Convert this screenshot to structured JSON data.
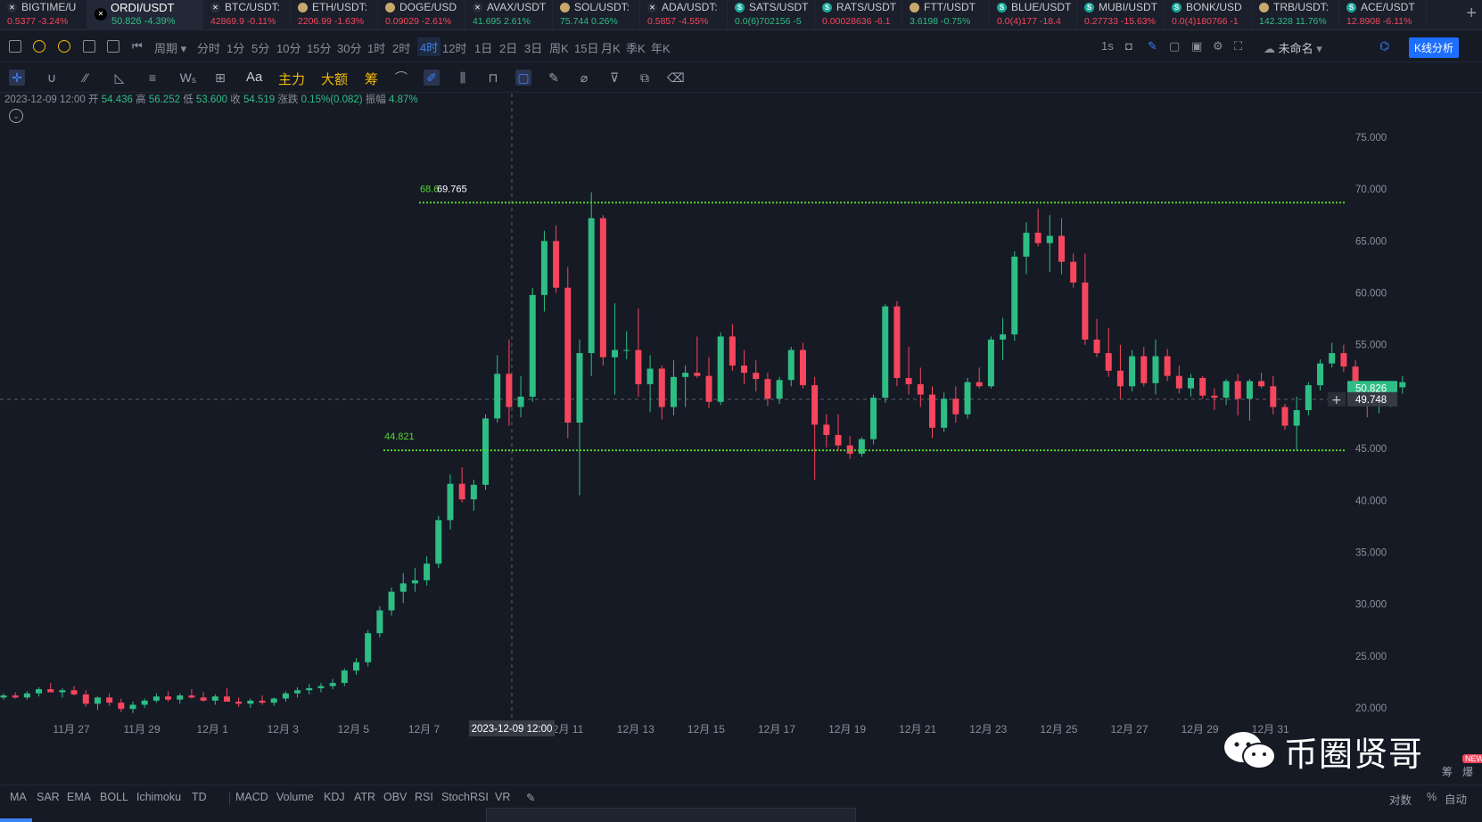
{
  "tickers": [
    {
      "symbol": "BIGTIME/U",
      "price": "0.5377",
      "change": "-3.24%",
      "dir": "dn",
      "icon": "x-logo-icon"
    },
    {
      "symbol": "ORDI/USDT",
      "price": "50.826",
      "change": "-4.39%",
      "dir": "up",
      "icon": "x-logo-icon",
      "active": true
    },
    {
      "symbol": "BTC/USDT:",
      "price": "42869.9",
      "change": "-0.11%",
      "dir": "dn",
      "icon": "x-logo-icon"
    },
    {
      "symbol": "ETH/USDT:",
      "price": "2206.99",
      "change": "-1.63%",
      "dir": "dn",
      "icon": "coin-icon"
    },
    {
      "symbol": "DOGE/USD",
      "price": "0.09029",
      "change": "-2.61%",
      "dir": "dn",
      "icon": "coin-icon"
    },
    {
      "symbol": "AVAX/USDT",
      "price": "41.695",
      "change": "2.61%",
      "dir": "up",
      "icon": "x-logo-icon"
    },
    {
      "symbol": "SOL/USDT:",
      "price": "75.744",
      "change": "0.26%",
      "dir": "up",
      "icon": "coin-icon"
    },
    {
      "symbol": "ADA/USDT:",
      "price": "0.5857",
      "change": "-4.55%",
      "dir": "dn",
      "icon": "x-logo-icon"
    },
    {
      "symbol": "SATS/USDT",
      "price": "0.0(6)702156",
      "change": "-5",
      "dir": "up",
      "icon": "s-logo-icon"
    },
    {
      "symbol": "RATS/USDT",
      "price": "0.00028636",
      "change": "-6.1",
      "dir": "dn",
      "icon": "s-logo-icon"
    },
    {
      "symbol": "FTT/USDT",
      "price": "3.6198",
      "change": "-0.75%",
      "dir": "up",
      "icon": "coin-icon"
    },
    {
      "symbol": "BLUE/USDT",
      "price": "0.0(4)177",
      "change": "-18.4",
      "dir": "dn",
      "icon": "s-logo-icon"
    },
    {
      "symbol": "MUBI/USDT",
      "price": "0.27733",
      "change": "-15.63%",
      "dir": "dn",
      "icon": "s-logo-icon"
    },
    {
      "symbol": "BONK/USD",
      "price": "0.0(4)180766",
      "change": "-1",
      "dir": "dn",
      "icon": "s-logo-icon"
    },
    {
      "symbol": "TRB/USDT:",
      "price": "142.328",
      "change": "11.76%",
      "dir": "up",
      "icon": "coin-icon"
    },
    {
      "symbol": "ACE/USDT",
      "price": "12.8908",
      "change": "-6.11%",
      "dir": "dn",
      "icon": "s-logo-icon"
    }
  ],
  "toolbar": {
    "period_label": "周期",
    "intervals": [
      "分时",
      "1分",
      "5分",
      "10分",
      "15分",
      "30分",
      "1时",
      "2时",
      "4时",
      "12时",
      "1日",
      "2日",
      "3日",
      "周K",
      "15日",
      "月K",
      "季K",
      "年K"
    ],
    "selected_interval": "4时",
    "refresh_label": "1s",
    "layout_name": "未命名",
    "kline_button": "K线分析"
  },
  "drawing_toolbar": {
    "text_tool": "Aa",
    "main_force": "主力",
    "big_amount": "大额",
    "chips": "筹"
  },
  "ohlc": {
    "datetime": "2023-12-09 12:00",
    "open_label": "开",
    "open": "54.436",
    "high_label": "高",
    "high": "56.252",
    "low_label": "低",
    "low": "53.600",
    "close_label": "收",
    "close": "54.519",
    "change_label": "涨跌",
    "change": "0.15%(0.082)",
    "amp_label": "振幅",
    "amp": "4.87%"
  },
  "chart_data": {
    "type": "candlestick",
    "ylim": [
      20000,
      76000
    ],
    "y_ticks": [
      "75.000",
      "70.000",
      "65.000",
      "60.000",
      "55.000",
      "50.000",
      "45.000",
      "40.000",
      "35.000",
      "30.000",
      "25.000",
      "20.000"
    ],
    "y_tick_values": [
      75,
      70,
      65,
      60,
      55,
      50,
      45,
      40,
      35,
      30,
      25,
      20
    ],
    "x_ticks": [
      "11月 27",
      "11月 29",
      "12月 1",
      "12月 3",
      "12月 5",
      "12月 7",
      "12月 9",
      "12月 11",
      "12月 13",
      "12月 15",
      "12月 17",
      "12月 19",
      "12月 21",
      "12月 23",
      "12月 25",
      "12月 27",
      "12月 29",
      "12月 31"
    ],
    "last_price": "50.826",
    "cursor_price": "49.748",
    "cursor_time": "2023-12-09 12:00",
    "resistance_level": 68.7,
    "resistance_label": "68.6",
    "peak_label": "69.765",
    "support_level": 44.82,
    "support_label": "44.821",
    "candles": [
      [
        21.0,
        21.4,
        20.8,
        21.2
      ],
      [
        21.2,
        21.5,
        20.9,
        21.0
      ],
      [
        21.0,
        21.6,
        20.8,
        21.4
      ],
      [
        21.4,
        22.0,
        21.1,
        21.8
      ],
      [
        21.8,
        22.4,
        21.5,
        21.5
      ],
      [
        21.5,
        21.9,
        21.0,
        21.7
      ],
      [
        21.7,
        22.1,
        21.2,
        21.3
      ],
      [
        21.3,
        21.7,
        20.1,
        20.4
      ],
      [
        20.4,
        21.1,
        19.8,
        21.0
      ],
      [
        21.0,
        21.4,
        20.2,
        20.5
      ],
      [
        20.5,
        20.9,
        19.6,
        19.9
      ],
      [
        19.9,
        20.6,
        19.5,
        20.3
      ],
      [
        20.3,
        20.9,
        20.0,
        20.7
      ],
      [
        20.7,
        21.4,
        20.5,
        21.1
      ],
      [
        21.1,
        21.6,
        20.6,
        20.8
      ],
      [
        20.8,
        21.4,
        20.4,
        21.2
      ],
      [
        21.2,
        21.8,
        20.9,
        21.0
      ],
      [
        21.0,
        21.5,
        20.6,
        20.7
      ],
      [
        20.7,
        21.3,
        20.3,
        21.1
      ],
      [
        21.1,
        21.9,
        20.8,
        20.6
      ],
      [
        20.6,
        21.0,
        20.1,
        20.4
      ],
      [
        20.4,
        20.9,
        20.0,
        20.7
      ],
      [
        20.7,
        21.2,
        20.3,
        20.5
      ],
      [
        20.5,
        21.0,
        20.2,
        20.9
      ],
      [
        20.9,
        21.6,
        20.6,
        21.4
      ],
      [
        21.4,
        22.0,
        21.0,
        21.7
      ],
      [
        21.7,
        22.3,
        21.3,
        21.9
      ],
      [
        21.9,
        22.4,
        21.5,
        22.1
      ],
      [
        22.1,
        22.8,
        21.8,
        22.4
      ],
      [
        22.4,
        23.8,
        22.1,
        23.6
      ],
      [
        23.6,
        24.8,
        23.2,
        24.4
      ],
      [
        24.4,
        27.5,
        24.0,
        27.2
      ],
      [
        27.2,
        29.8,
        26.8,
        29.4
      ],
      [
        29.4,
        31.6,
        28.9,
        31.2
      ],
      [
        31.2,
        33.0,
        30.1,
        32.0
      ],
      [
        32.0,
        33.5,
        31.2,
        32.3
      ],
      [
        32.3,
        34.6,
        31.8,
        33.9
      ],
      [
        33.9,
        38.5,
        33.5,
        38.1
      ],
      [
        38.1,
        42.5,
        37.2,
        41.6
      ],
      [
        41.6,
        43.2,
        39.8,
        40.1
      ],
      [
        40.1,
        42.0,
        39.0,
        41.5
      ],
      [
        41.5,
        48.3,
        41.0,
        47.9
      ],
      [
        47.9,
        54.0,
        47.5,
        52.2
      ],
      [
        52.2,
        55.5,
        47.2,
        49.0
      ],
      [
        49.0,
        52.0,
        48.0,
        50.0
      ],
      [
        50.0,
        60.5,
        49.5,
        59.8
      ],
      [
        59.8,
        66.0,
        58.2,
        65.0
      ],
      [
        65.0,
        66.5,
        60.0,
        60.5
      ],
      [
        60.5,
        62.5,
        46.0,
        47.5
      ],
      [
        47.5,
        55.5,
        40.5,
        54.2
      ],
      [
        54.2,
        69.7,
        52.0,
        67.2
      ],
      [
        67.2,
        67.5,
        53.0,
        53.8
      ],
      [
        53.8,
        59.0,
        50.2,
        54.5
      ],
      [
        54.5,
        56.3,
        53.6,
        54.5
      ],
      [
        54.5,
        58.5,
        50.0,
        51.2
      ],
      [
        51.2,
        54.0,
        48.5,
        52.7
      ],
      [
        52.7,
        53.0,
        47.8,
        49.0
      ],
      [
        49.0,
        53.5,
        48.2,
        51.9
      ],
      [
        51.9,
        53.0,
        49.0,
        52.3
      ],
      [
        52.3,
        55.8,
        51.8,
        52.0
      ],
      [
        52.0,
        53.8,
        48.9,
        49.5
      ],
      [
        49.5,
        56.2,
        49.2,
        55.8
      ],
      [
        55.8,
        57.0,
        52.5,
        53.0
      ],
      [
        53.0,
        54.5,
        51.2,
        52.3
      ],
      [
        52.3,
        53.5,
        50.5,
        51.7
      ],
      [
        51.7,
        52.3,
        49.1,
        49.8
      ],
      [
        49.8,
        51.9,
        49.3,
        51.6
      ],
      [
        51.6,
        54.8,
        51.0,
        54.5
      ],
      [
        54.5,
        55.2,
        50.8,
        51.1
      ],
      [
        51.1,
        51.9,
        42.0,
        47.3
      ],
      [
        47.3,
        48.3,
        45.1,
        46.3
      ],
      [
        46.3,
        48.3,
        44.8,
        45.3
      ],
      [
        45.3,
        46.2,
        44.0,
        44.5
      ],
      [
        44.5,
        46.1,
        44.2,
        45.9
      ],
      [
        45.9,
        50.2,
        45.4,
        49.9
      ],
      [
        49.9,
        58.9,
        49.4,
        58.7
      ],
      [
        58.7,
        59.2,
        51.0,
        51.8
      ],
      [
        51.8,
        54.8,
        50.2,
        51.2
      ],
      [
        51.2,
        52.8,
        49.0,
        50.2
      ],
      [
        50.2,
        51.0,
        46.0,
        47.0
      ],
      [
        47.0,
        50.4,
        46.6,
        49.8
      ],
      [
        49.8,
        51.0,
        47.5,
        48.3
      ],
      [
        48.3,
        51.8,
        47.9,
        51.4
      ],
      [
        51.4,
        52.8,
        50.8,
        51.0
      ],
      [
        51.0,
        55.8,
        50.8,
        55.5
      ],
      [
        55.5,
        57.6,
        53.5,
        56.0
      ],
      [
        56.0,
        64.0,
        55.4,
        63.5
      ],
      [
        63.5,
        66.8,
        61.8,
        65.8
      ],
      [
        65.8,
        68.1,
        64.5,
        64.8
      ],
      [
        64.8,
        67.5,
        62.0,
        65.5
      ],
      [
        65.5,
        67.2,
        61.8,
        63.0
      ],
      [
        63.0,
        63.8,
        60.5,
        61.0
      ],
      [
        61.0,
        63.8,
        55.0,
        55.5
      ],
      [
        55.5,
        57.5,
        53.8,
        54.2
      ],
      [
        54.2,
        56.6,
        51.9,
        52.5
      ],
      [
        52.5,
        55.0,
        49.8,
        51.0
      ],
      [
        51.0,
        54.5,
        50.5,
        53.9
      ],
      [
        53.9,
        54.8,
        51.0,
        51.3
      ],
      [
        51.3,
        55.5,
        50.2,
        53.9
      ],
      [
        53.9,
        54.6,
        51.5,
        52.0
      ],
      [
        52.0,
        53.0,
        50.3,
        50.8
      ],
      [
        50.8,
        52.2,
        50.0,
        51.8
      ],
      [
        51.8,
        52.0,
        49.8,
        50.1
      ],
      [
        50.1,
        50.8,
        48.7,
        49.9
      ],
      [
        49.9,
        51.7,
        49.2,
        51.5
      ],
      [
        51.5,
        52.2,
        48.2,
        49.8
      ],
      [
        49.8,
        51.7,
        47.7,
        51.5
      ],
      [
        51.5,
        52.3,
        50.8,
        51.0
      ],
      [
        51.0,
        52.0,
        48.3,
        49.0
      ],
      [
        49.0,
        49.3,
        46.8,
        47.2
      ],
      [
        47.2,
        50.0,
        44.9,
        48.7
      ],
      [
        48.7,
        51.4,
        48.2,
        51.1
      ],
      [
        51.1,
        53.6,
        50.6,
        53.2
      ],
      [
        53.2,
        55.2,
        52.8,
        54.2
      ],
      [
        54.2,
        55.0,
        52.4,
        52.9
      ],
      [
        52.9,
        53.5,
        49.2,
        49.9
      ],
      [
        49.9,
        50.8,
        48.0,
        49.2
      ],
      [
        49.2,
        51.2,
        48.4,
        50.1
      ],
      [
        50.1,
        51.2,
        49.0,
        50.9
      ],
      [
        50.9,
        52.0,
        50.3,
        51.4
      ]
    ]
  },
  "bottom": {
    "indicators": [
      "MA",
      "SAR",
      "EMA",
      "BOLL",
      "Ichimoku",
      "TD",
      "MACD",
      "Volume",
      "KDJ",
      "ATR",
      "OBV",
      "RSI",
      "StochRSI",
      "VR"
    ],
    "log_label": "对数",
    "percent_label": "%",
    "auto_label": "自动"
  },
  "watermark": {
    "text": "币圈贤哥",
    "badge": "NEW"
  },
  "colors": {
    "up": "#2ebd85",
    "down": "#f6465d",
    "background": "#161a25",
    "level_line": "#54d62c",
    "accent": "#1e6fff"
  }
}
